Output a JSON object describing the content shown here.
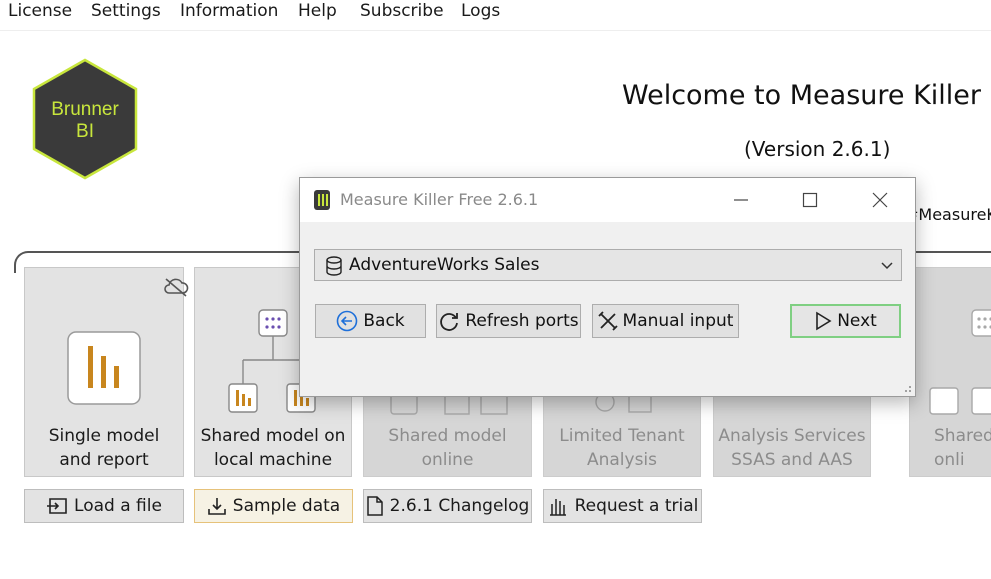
{
  "menu": [
    "License",
    "Settings",
    "Information",
    "Help",
    "Subscribe",
    "Logs"
  ],
  "logo": {
    "line1": "Brunner",
    "line2": "BI"
  },
  "header": {
    "welcome": "Welcome to Measure Killer",
    "version": "(Version 2.6.1)",
    "hashtag": "#MeasureK"
  },
  "cards": [
    {
      "label": "Single model\nand report",
      "enabled": true
    },
    {
      "label": "Shared model on\nlocal machine",
      "enabled": true
    },
    {
      "label": "Shared model\nonline",
      "enabled": false
    },
    {
      "label": "Limited Tenant\nAnalysis",
      "enabled": false
    },
    {
      "label": "Analysis Services\nSSAS and AAS",
      "enabled": false
    },
    {
      "label": "Shared\nonli",
      "enabled": false
    }
  ],
  "bottom_buttons": {
    "load": "Load a file",
    "sample": "Sample data",
    "changelog": "2.6.1 Changelog",
    "trial": "Request a trial"
  },
  "dialog": {
    "title": "Measure Killer Free 2.6.1",
    "selected_model": "AdventureWorks Sales",
    "back": "Back",
    "refresh": "Refresh ports",
    "manual": "Manual input",
    "next": "Next"
  },
  "colors": {
    "logo_fill": "#3a3a3a",
    "logo_border": "#c8e63c",
    "bar_icon": "#c8861e",
    "next_border": "#7fcf82",
    "back_icon": "#1e6fd9"
  }
}
